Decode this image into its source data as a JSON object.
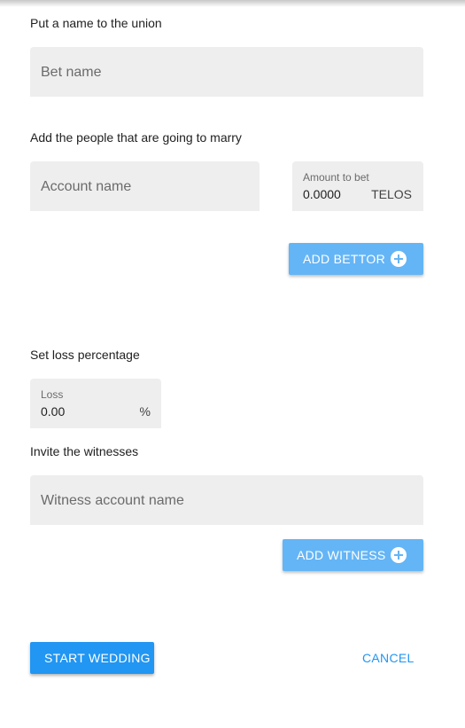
{
  "union": {
    "label": "Put a name to the union",
    "bet_name_placeholder": "Bet name"
  },
  "people": {
    "label": "Add the people that are going to marry",
    "account_placeholder": "Account name",
    "amount_label": "Amount to bet",
    "amount_value": "0.0000",
    "amount_unit": "TELOS",
    "add_bettor_label": "ADD BETTOR"
  },
  "loss": {
    "label": "Set loss percentage",
    "field_label": "Loss",
    "value": "0.00",
    "unit": "%"
  },
  "witnesses": {
    "label": "Invite the witnesses",
    "witness_placeholder": "Witness account name",
    "add_witness_label": "ADD WITNESS"
  },
  "actions": {
    "start_label": "START WEDDING",
    "cancel_label": "CANCEL"
  },
  "icons": {
    "add": "plus-circle-icon"
  },
  "colors": {
    "primary": "#2196f3",
    "primary_light": "#64b5f6",
    "field_bg": "#eeeeee"
  }
}
